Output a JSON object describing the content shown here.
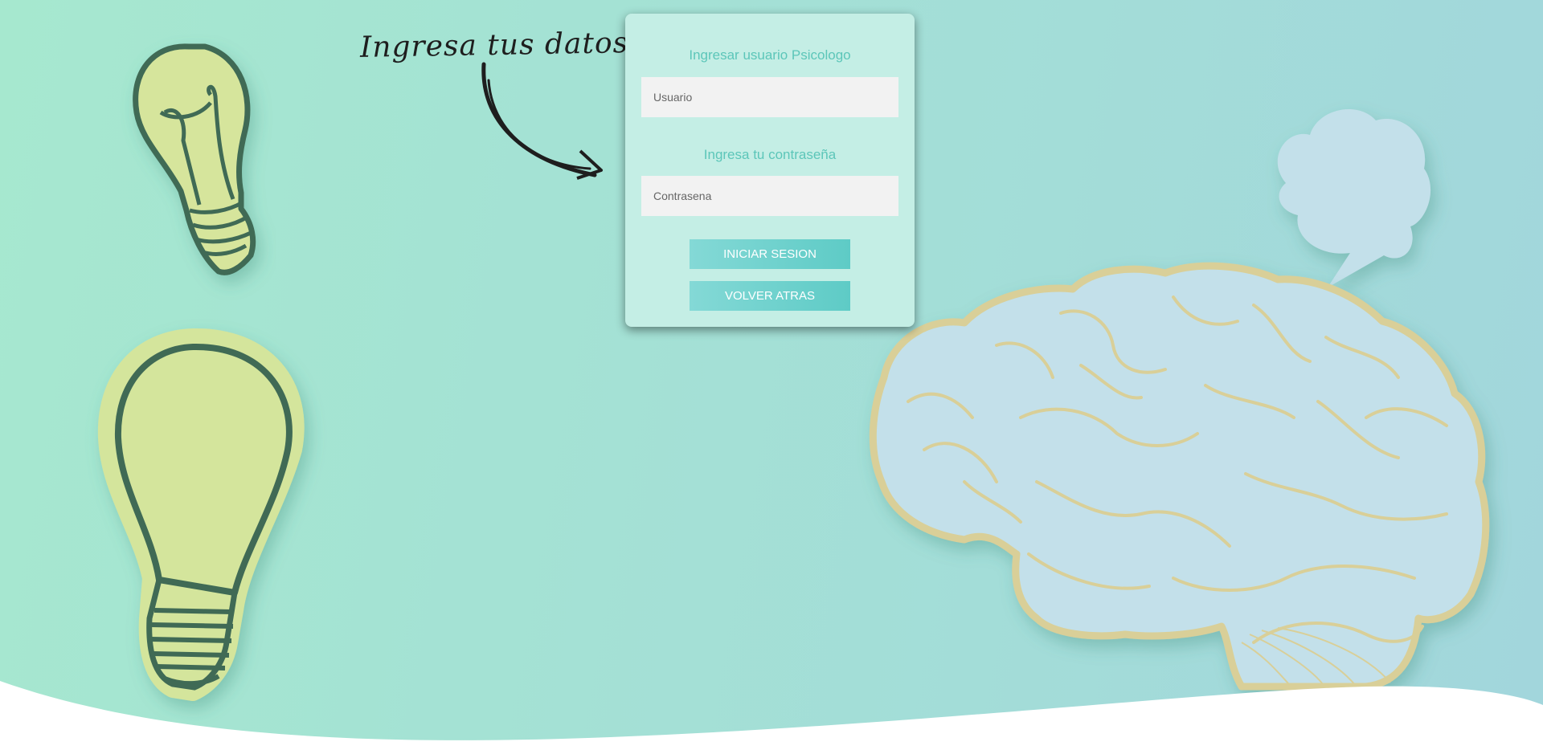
{
  "hero": {
    "handwritten_note": "Ingresa tus datos"
  },
  "login_form": {
    "user_label": "Ingresar usuario Psicologo",
    "user_placeholder": "Usuario",
    "password_label": "Ingresa tu contraseña",
    "password_placeholder": "Contrasena",
    "login_button": "INICIAR SESION",
    "back_button": "VOLVER ATRAS"
  },
  "illustrations": {
    "decor": [
      "lightbulb-small-icon",
      "lightbulb-large-icon",
      "curved-arrow-icon",
      "brain-icon",
      "speech-cloud-icon"
    ]
  },
  "colors": {
    "accent": "#5ecbc6",
    "label_text": "#5cc6b9",
    "card_bg": "#c4eee5",
    "bulb_fill": "#d4e59c",
    "bulb_outline": "#3f6b55",
    "brain_fill": "#c3e0ea",
    "brain_outline": "#d9cf98"
  }
}
